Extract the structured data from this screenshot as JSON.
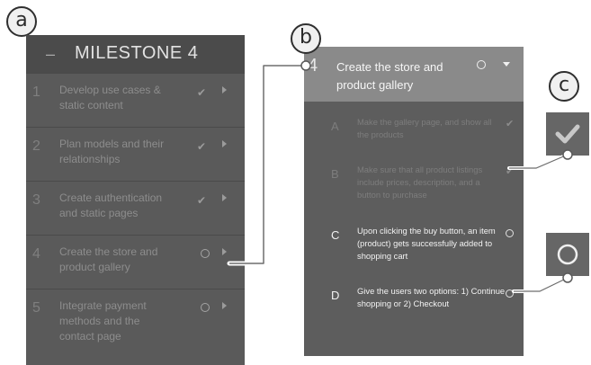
{
  "callouts": {
    "a": "a",
    "b": "b",
    "c": "c"
  },
  "left_panel": {
    "collapse_symbol": "–",
    "title": "MILESTONE 4",
    "tasks": [
      {
        "number": "1",
        "label": "Develop use cases & static content",
        "status": "done"
      },
      {
        "number": "2",
        "label": "Plan models and their relationships",
        "status": "done"
      },
      {
        "number": "3",
        "label": "Create authentication and static pages",
        "status": "done"
      },
      {
        "number": "4",
        "label": "Create the store and product gallery",
        "status": "open"
      },
      {
        "number": "5",
        "label": "Integrate payment methods and the contact page",
        "status": "open"
      }
    ]
  },
  "right_panel": {
    "number": "4",
    "title": "Create the store and product gallery",
    "subtasks": [
      {
        "letter": "A",
        "text": "Make the gallery page, and show all the products",
        "status": "done"
      },
      {
        "letter": "B",
        "text": "Make sure that all product listings include prices, description, and a button to purchase",
        "status": "done"
      },
      {
        "letter": "C",
        "text": "Upon clicking the buy button, an item (product) gets successfully added to shopping cart",
        "status": "open"
      },
      {
        "letter": "D",
        "text": "Give the users two options: 1) Continue shopping or 2) Checkout",
        "status": "open"
      }
    ]
  },
  "legend": {
    "done_icon": "check-icon",
    "open_icon": "circle-icon"
  },
  "colors": {
    "panel_dark": "#5a5a5a",
    "header_dark": "#4b4b4b",
    "header_selected": "#8a8a8a",
    "icon_box": "#666666",
    "connector": "#ffffff"
  }
}
